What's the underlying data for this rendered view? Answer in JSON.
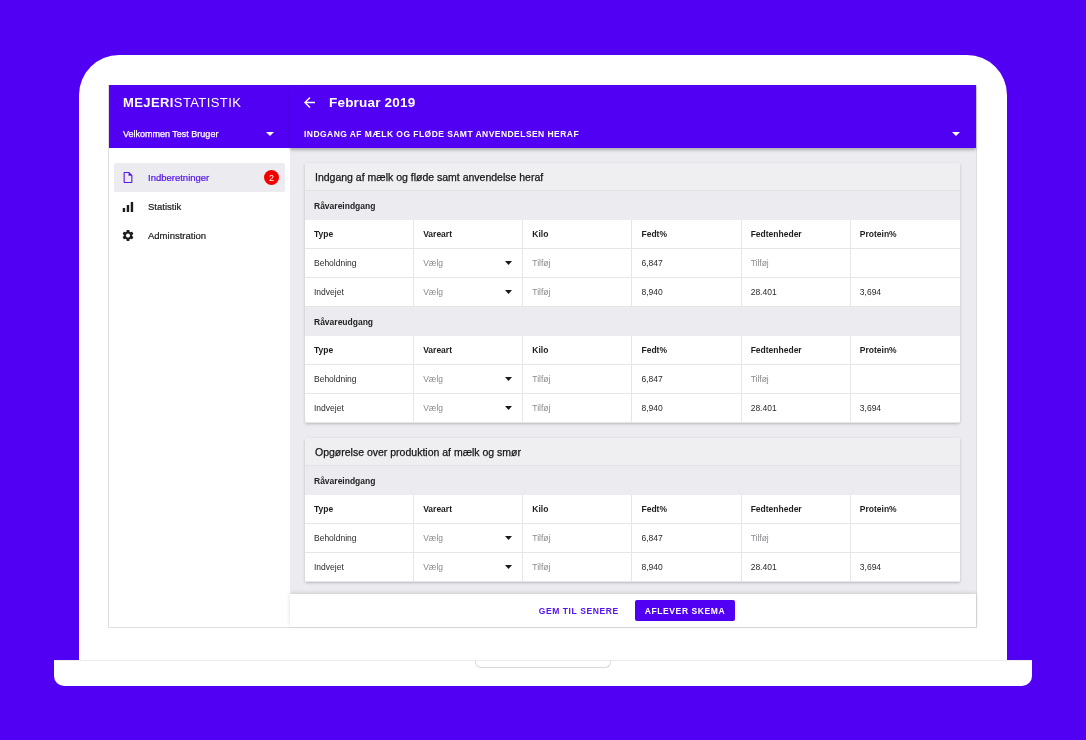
{
  "app": {
    "logo": "**MEJERI**STATISTIK",
    "user_menu": "Velkommen Test Bruger"
  },
  "sidebar": {
    "items": [
      {
        "label": "Indberetninger",
        "selected": true,
        "badge": "2"
      },
      {
        "label": "Statistik",
        "selected": false
      },
      {
        "label": "Adminstration",
        "selected": false
      }
    ]
  },
  "header": {
    "title": "Februar 2019",
    "section_dropdown": "INDGANG AF MÆLK OG FLØDE SAMT ANVENDELSEN HERAF"
  },
  "cards": [
    {
      "title": "Indgang af mælk og fløde samt anvendelse heraf",
      "groups": [
        {
          "title": "Råvareindgang",
          "columns": [
            "Type",
            "Vareart",
            "Kilo",
            "Fedt%",
            "Fedtenheder",
            "Protein%"
          ],
          "rows": [
            [
              {
                "kind": "text",
                "text": "Beholdning"
              },
              {
                "kind": "select",
                "placeholder": "Vælg"
              },
              {
                "kind": "input",
                "placeholder": "Tilføj"
              },
              {
                "kind": "text",
                "text": "6,847"
              },
              {
                "kind": "input",
                "placeholder": "Tilføj"
              },
              {
                "kind": "blank"
              }
            ],
            [
              {
                "kind": "text",
                "text": "Indvejet"
              },
              {
                "kind": "select",
                "placeholder": "Vælg"
              },
              {
                "kind": "input",
                "placeholder": "Tilføj"
              },
              {
                "kind": "text",
                "text": "8,940"
              },
              {
                "kind": "text",
                "text": "28.401"
              },
              {
                "kind": "text",
                "text": "3,694"
              }
            ]
          ]
        },
        {
          "title": "Råvareudgang",
          "columns": [
            "Type",
            "Vareart",
            "Kilo",
            "Fedt%",
            "Fedtenheder",
            "Protein%"
          ],
          "rows": [
            [
              {
                "kind": "text",
                "text": "Beholdning"
              },
              {
                "kind": "select",
                "placeholder": "Vælg"
              },
              {
                "kind": "input",
                "placeholder": "Tilføj"
              },
              {
                "kind": "text",
                "text": "6,847"
              },
              {
                "kind": "input",
                "placeholder": "Tilføj"
              },
              {
                "kind": "blank"
              }
            ],
            [
              {
                "kind": "text",
                "text": "Indvejet"
              },
              {
                "kind": "select",
                "placeholder": "Vælg"
              },
              {
                "kind": "input",
                "placeholder": "Tilføj"
              },
              {
                "kind": "text",
                "text": "8,940"
              },
              {
                "kind": "text",
                "text": "28.401"
              },
              {
                "kind": "text",
                "text": "3,694"
              }
            ]
          ]
        }
      ]
    },
    {
      "title": "Opgørelse over produktion af mælk og smør",
      "groups": [
        {
          "title": "Råvareindgang",
          "columns": [
            "Type",
            "Vareart",
            "Kilo",
            "Fedt%",
            "Fedtenheder",
            "Protein%"
          ],
          "rows": [
            [
              {
                "kind": "text",
                "text": "Beholdning"
              },
              {
                "kind": "select",
                "placeholder": "Vælg"
              },
              {
                "kind": "input",
                "placeholder": "Tilføj"
              },
              {
                "kind": "text",
                "text": "6,847"
              },
              {
                "kind": "input",
                "placeholder": "Tilføj"
              },
              {
                "kind": "blank"
              }
            ],
            [
              {
                "kind": "text",
                "text": "Indvejet"
              },
              {
                "kind": "select",
                "placeholder": "Vælg"
              },
              {
                "kind": "input",
                "placeholder": "Tilføj"
              },
              {
                "kind": "text",
                "text": "8,940"
              },
              {
                "kind": "text",
                "text": "28.401"
              },
              {
                "kind": "text",
                "text": "3,694"
              }
            ]
          ]
        }
      ]
    }
  ],
  "footer": {
    "buttons": [
      {
        "label": "GEM TIL SENERE",
        "kind": "text"
      },
      {
        "label": "AFLEVER SKEMA",
        "kind": "filled"
      }
    ]
  }
}
